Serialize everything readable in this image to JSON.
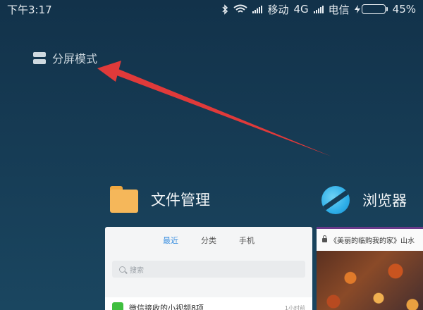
{
  "status_bar": {
    "time": "下午3:17",
    "carrier1": "移动",
    "network": "4G",
    "carrier2": "电信",
    "battery_percent": "45%",
    "battery_level": 0.45,
    "icons": [
      "bluetooth-icon",
      "wifi-icon",
      "signal-icon",
      "charging-icon",
      "battery-icon"
    ]
  },
  "split_mode": {
    "label": "分屏模式",
    "icon": "split-screen-icon"
  },
  "annotation": {
    "arrow_color": "#e03a3a"
  },
  "apps": [
    {
      "name": "文件管理",
      "icon": "folder-icon",
      "tabs": [
        "最近",
        "分类",
        "手机"
      ],
      "active_tab": "最近",
      "search_placeholder": "搜索",
      "row_title": "微信接收的小视频8项",
      "row_time": "1小时前"
    },
    {
      "name": "浏览器",
      "icon": "browser-icon",
      "url_text": "《美丽的临购我的家》山水"
    }
  ],
  "colors": {
    "background": "#163b54",
    "accent_tab": "#3a8fe0",
    "battery_fill": "#3fd45b",
    "folder": "#f5b75a",
    "browser": "#2eaee8"
  }
}
